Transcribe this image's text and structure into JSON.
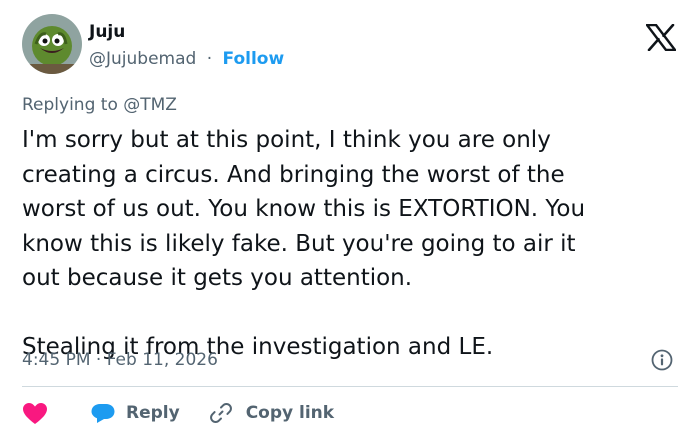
{
  "author": {
    "name": "Juju",
    "handle": "@Jujubemad",
    "separator": "·",
    "follow_label": "Follow"
  },
  "reply_context": {
    "prefix": "Replying to",
    "mention": "@TMZ"
  },
  "tweet": {
    "lines": [
      "I'm sorry but at this point, I think you are only",
      "creating a circus. And bringing the worst of the",
      "worst of us out. You know this is EXTORTION. You",
      "know this is likely fake. But you're going to air it",
      "out because it gets you attention."
    ],
    "closing": "Stealing it from the investigation and LE."
  },
  "timestamp": "4:45 PM · Feb 11, 2026",
  "actions": {
    "reply_label": "Reply",
    "copy_link_label": "Copy link"
  },
  "colors": {
    "accent": "#1d9bf0",
    "heart": "#f91880",
    "secondary_text": "#536471",
    "divider": "#cfd9de"
  },
  "icons": [
    "x-logo-icon",
    "info-icon",
    "heart-icon",
    "reply-bubble-icon",
    "link-icon"
  ]
}
